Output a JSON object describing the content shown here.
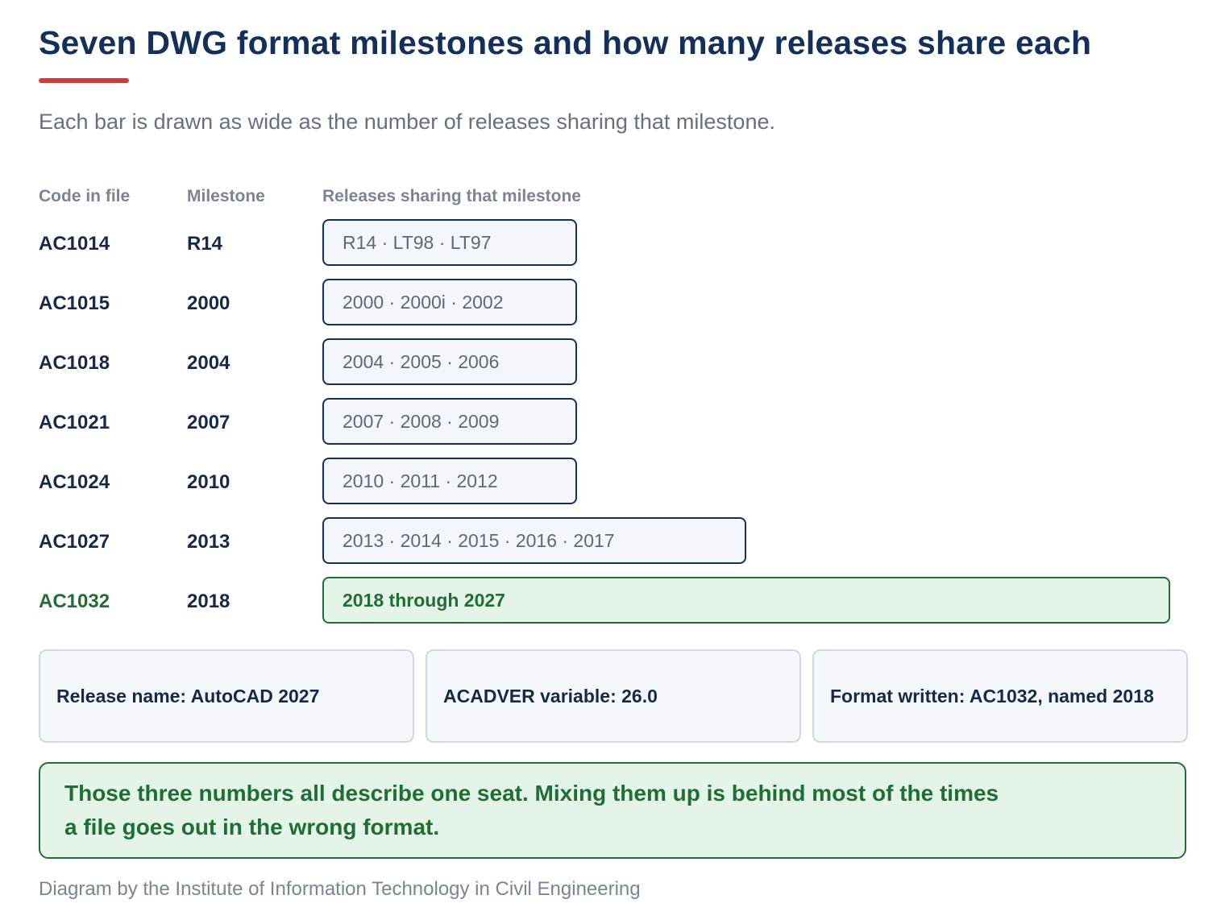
{
  "title": "Seven DWG format milestones and how many releases share each",
  "subtitle": "Each bar is drawn as wide as the number of releases sharing that milestone.",
  "columns": {
    "code": "Code in file",
    "milestone": "Milestone",
    "releases": "Releases sharing that milestone"
  },
  "rows": [
    {
      "code": "AC1014",
      "milestone": "R14",
      "releases": "R14 · LT98 · LT97",
      "count": 3
    },
    {
      "code": "AC1015",
      "milestone": "2000",
      "releases": "2000 · 2000i · 2002",
      "count": 3
    },
    {
      "code": "AC1018",
      "milestone": "2004",
      "releases": "2004 · 2005 · 2006",
      "count": 3
    },
    {
      "code": "AC1021",
      "milestone": "2007",
      "releases": "2007 · 2008 · 2009",
      "count": 3
    },
    {
      "code": "AC1024",
      "milestone": "2010",
      "releases": "2010 · 2011 · 2012",
      "count": 3
    },
    {
      "code": "AC1027",
      "milestone": "2013",
      "releases": "2013 · 2014 · 2015 · 2016 · 2017",
      "count": 5
    },
    {
      "code": "AC1032",
      "milestone": "2018",
      "releases": "2018 through 2027",
      "count": 10
    }
  ],
  "info_boxes": [
    "Release name: AutoCAD 2027",
    "ACADVER variable: 26.0",
    "Format written: AC1032, named 2018"
  ],
  "callout": "Those three numbers all describe one seat. Mixing them up is behind most of the times a file goes out in the wrong format.",
  "footer": "Diagram by the Institute of Information Technology in Civil Engineering",
  "colors": {
    "title": "#14305a",
    "accent_rule": "#d23b3b",
    "bar_border": "#14305a",
    "current_green": "#1f6e35",
    "current_fill": "#e5f4e9"
  }
}
